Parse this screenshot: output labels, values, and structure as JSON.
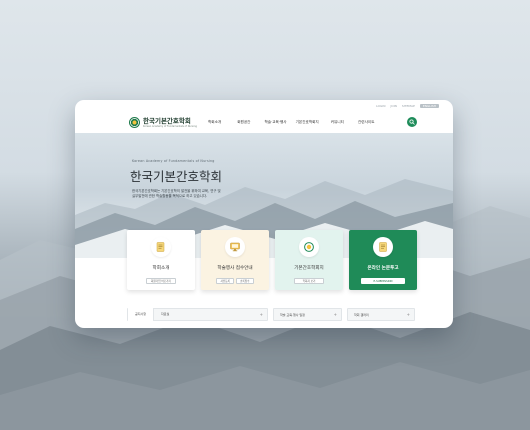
{
  "utility": {
    "login": "LOGIN",
    "join": "JOIN",
    "sitemap": "SITEMAP",
    "english": "ENGLISH"
  },
  "logo": {
    "name_ko": "한국기본간호학회",
    "name_en": "Korean Academy of Fundamentals of Nursing"
  },
  "nav": [
    "학회소개",
    "회원공간",
    "학술·교육·행사",
    "기본간호학회지",
    "커뮤니티",
    "관련사이트"
  ],
  "hero": {
    "subtitle": "Korean Academy of Fundamentals of Nursing",
    "title": "한국기본간호학회",
    "desc_line1": "한국기본간호학회는 기본간호학의 발전을 위하여 교육, 연구 및",
    "desc_line2": "실무발전에 관한 학술활동을 목적으로 하고 있습니다."
  },
  "cards": [
    {
      "title": "학회소개",
      "buttons": [
        "회원가입 바로가기"
      ]
    },
    {
      "title": "학술행사 접수안내",
      "buttons": [
        "사전등록",
        "초록접수"
      ]
    },
    {
      "title": "기본간호학회지",
      "buttons": [
        "학회지 보기"
      ]
    },
    {
      "title": "온라인 논문투고",
      "buttons": [
        "E-SUBMISSION"
      ]
    }
  ],
  "bottom": {
    "tab_notice": "공지사항",
    "tab_archive": "자료실",
    "events_label": "학술·교육·행사 일정",
    "photo_label": "학회 갤러리"
  },
  "colors": {
    "brand_green": "#1f8b58",
    "mint_card": "#e2f3ee",
    "cream_card": "#fbf3e2"
  }
}
